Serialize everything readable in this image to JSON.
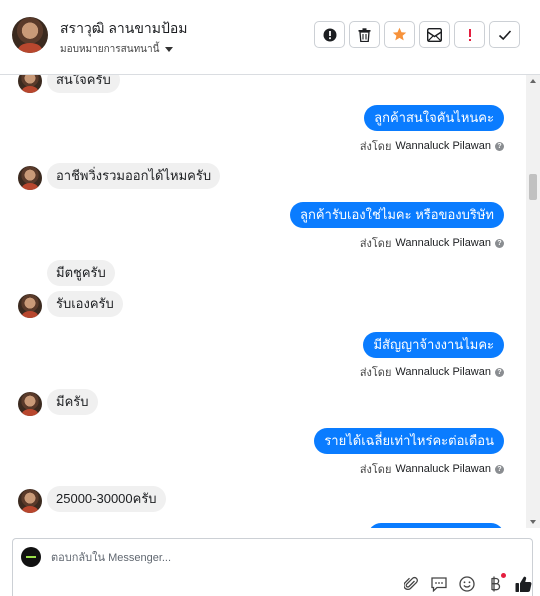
{
  "header": {
    "name": "สราวุฒิ ลานขามป้อม",
    "assign": "มอบหมายการสนทนานี้",
    "actions": [
      {
        "name": "mark-spam-button",
        "icon": "alert-circle-icon"
      },
      {
        "name": "delete-button",
        "icon": "trash-icon"
      },
      {
        "name": "star-button",
        "icon": "star-icon",
        "color": "#f7923a"
      },
      {
        "name": "mark-unread-button",
        "icon": "envelope-icon"
      },
      {
        "name": "follow-up-button",
        "icon": "exclamation-icon",
        "color": "#e41e3f"
      },
      {
        "name": "done-button",
        "icon": "checkmark-icon"
      }
    ]
  },
  "messages": {
    "m1": "สนใจครับ",
    "m2": "ลูกค้าสนใจคันไหนคะ",
    "m3": "อาชีพวิ่งรวมออกได้ไหมครับ",
    "m4": "ลูกค้ารับเองใช่ไมคะ หรือของบริษัท",
    "m5": "มีตชูครับ",
    "m6": "รับเองครับ",
    "m7": "มีสัญญาจ้างงานไมคะ",
    "m8": "มีครับ",
    "m9": "รายได้เฉลี่ยเท่าไหร่คะต่อเดือน",
    "m10": "25000-30000ครับ"
  },
  "sent_by": {
    "prefix": "ส่งโดย",
    "agent": "Wannaluck Pilawan"
  },
  "composer": {
    "placeholder": "ตอบกลับใน Messenger..."
  },
  "colors": {
    "outgoing_bubble": "#0a7cff",
    "incoming_bubble": "#f0f0f0",
    "like_icon": "#1c1e21"
  }
}
